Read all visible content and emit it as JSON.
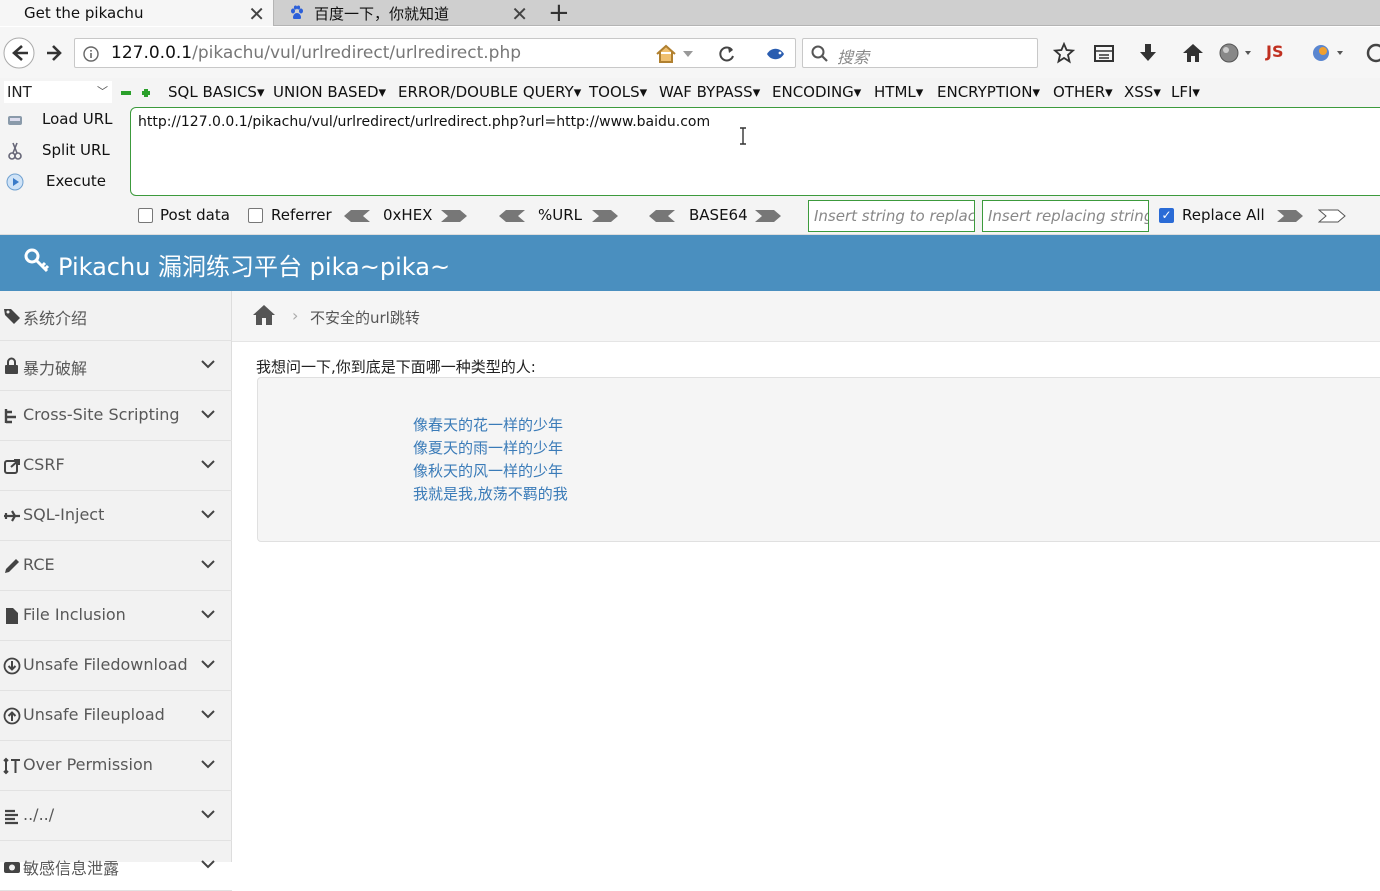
{
  "browser": {
    "tabs": [
      {
        "title": "Get the pikachu",
        "active": true
      },
      {
        "title": "百度一下，你就知道",
        "active": false
      }
    ],
    "url": {
      "host": "127.0.0.1",
      "path": "/pikachu/vul/urlredirect/urlredirect.php"
    },
    "search_placeholder": "搜索",
    "toolbar_js_label": "JS"
  },
  "hackbar": {
    "select_value": "INT",
    "menus": [
      "SQL BASICS",
      "UNION BASED",
      "ERROR/DOUBLE QUERY",
      "TOOLS",
      "WAF BYPASS",
      "ENCODING",
      "HTML",
      "ENCRYPTION",
      "OTHER",
      "XSS",
      "LFI"
    ],
    "actions": {
      "load": "Load URL",
      "split": "Split URL",
      "execute": "Execute"
    },
    "url_value": "http://127.0.0.1/pikachu/vul/urlredirect/urlredirect.php?url=http://www.baidu.com",
    "post_data_label": "Post data",
    "referrer_label": "Referrer",
    "encoders": [
      "0xHEX",
      "%URL",
      "BASE64"
    ],
    "replace_placeholder": "Insert string to replace",
    "replacing_placeholder": "Insert replacing string",
    "replace_all_label": "Replace All",
    "replace_all_checked": true,
    "accent_color": "#3c9a3c"
  },
  "site": {
    "title": "Pikachu 漏洞练习平台 pika~pika~",
    "header_color": "#4a8fbf",
    "sidebar": [
      {
        "label": "系统介绍",
        "icon": "tags-icon"
      },
      {
        "label": "暴力破解",
        "icon": "lock-icon"
      },
      {
        "label": "Cross-Site Scripting",
        "icon": "sitemap-icon"
      },
      {
        "label": "CSRF",
        "icon": "share-icon"
      },
      {
        "label": "SQL-Inject",
        "icon": "plane-icon"
      },
      {
        "label": "RCE",
        "icon": "pencil-icon"
      },
      {
        "label": "File Inclusion",
        "icon": "file-icon"
      },
      {
        "label": "Unsafe Filedownload",
        "icon": "download-icon"
      },
      {
        "label": "Unsafe Fileupload",
        "icon": "upload-icon"
      },
      {
        "label": "Over Permission",
        "icon": "text-height-icon"
      },
      {
        "label": "../../",
        "icon": "list-icon"
      },
      {
        "label": "敏感信息泄露",
        "icon": "camera-icon"
      }
    ],
    "breadcrumb": "不安全的url跳转",
    "question": "我想问一下,你到底是下面哪一种类型的人:",
    "options": [
      "像春天的花一样的少年",
      "像夏天的雨一样的少年",
      "像秋天的风一样的少年",
      "我就是我,放荡不羁的我"
    ],
    "link_color": "#3a7bb8"
  }
}
